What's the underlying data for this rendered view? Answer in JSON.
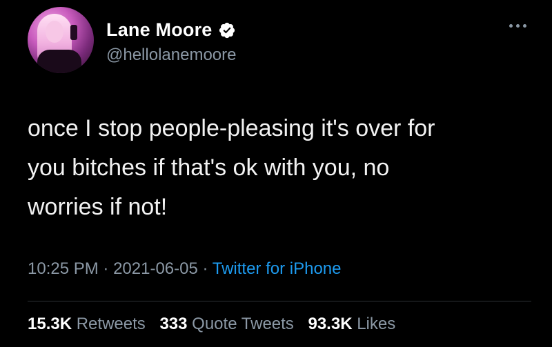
{
  "user": {
    "name": "Lane Moore",
    "handle": "@hellolanemoore",
    "verified_color": "#1d9bf0"
  },
  "tweet": {
    "lines": [
      "once I stop people-pleasing it's over for",
      "you bitches if that's ok with you, no",
      "worries if not!"
    ],
    "time": "10:25 PM",
    "separator": "·",
    "date": "2021-06-05",
    "source": "Twitter for iPhone"
  },
  "stats": {
    "retweets_count": "15.3K",
    "retweets_label": "Retweets",
    "quotes_count": "333",
    "quotes_label": "Quote Tweets",
    "likes_count": "93.3K",
    "likes_label": "Likes"
  },
  "icons": {
    "more": "more-options-icon",
    "verified": "verified-badge-icon"
  },
  "colors": {
    "background": "#000000",
    "link": "#1d9bf0",
    "muted": "#8b98a5"
  }
}
